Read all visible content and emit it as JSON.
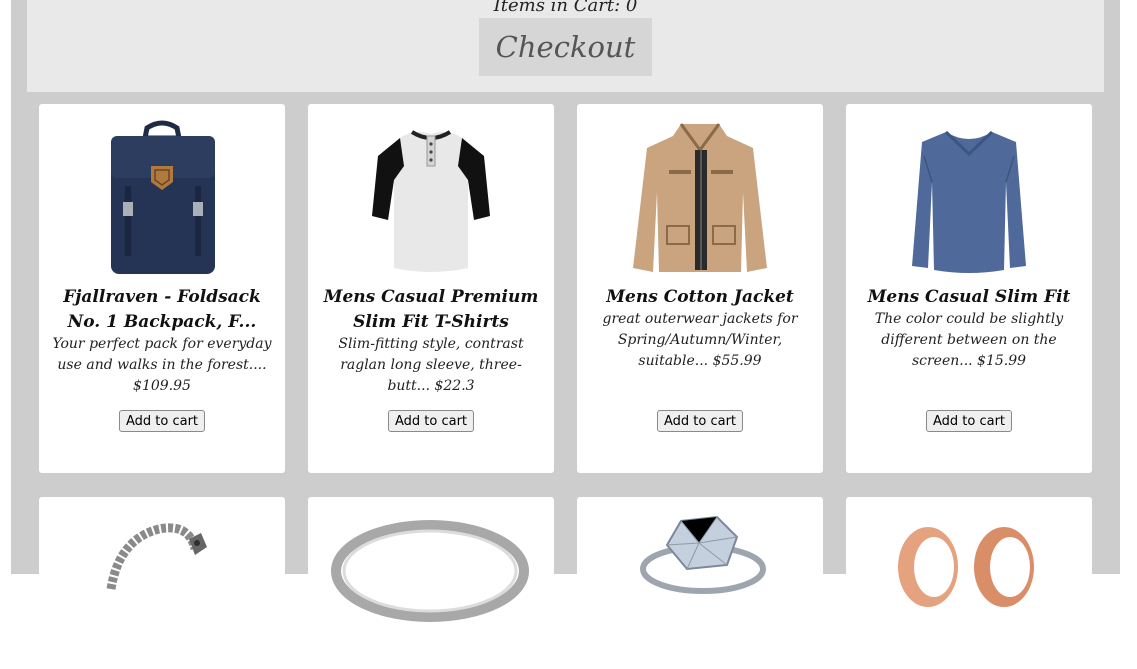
{
  "header": {
    "items_in_cart": "Items in Cart: 0",
    "checkout_label": "Checkout"
  },
  "products": [
    {
      "title": "Fjallraven - Foldsack No. 1 Backpack, F...",
      "description": "Your perfect pack for everyday use and walks in the forest.... $109.95",
      "button": "Add to cart",
      "image": "backpack-image"
    },
    {
      "title": "Mens Casual Premium Slim Fit T-Shirts",
      "description": "Slim-fitting style, contrast raglan long sleeve, three-butt... $22.3",
      "button": "Add to cart",
      "image": "tshirt-image"
    },
    {
      "title": "Mens Cotton Jacket",
      "description": "great outerwear jackets for Spring/Autumn/Winter, suitable... $55.99",
      "button": "Add to cart",
      "image": "jacket-image"
    },
    {
      "title": "Mens Casual Slim Fit",
      "description": "The color could be slightly different between on the screen... $15.99",
      "button": "Add to cart",
      "image": "longsleeve-shirt-image"
    }
  ],
  "row2": [
    {
      "image": "bracelet-image"
    },
    {
      "image": "silver-ring-image"
    },
    {
      "image": "diamond-ring-image"
    },
    {
      "image": "rose-gold-rings-image"
    }
  ],
  "colors": {
    "page_bg": "#cdcdcd",
    "header_bg": "#e9e9e9",
    "checkout_bg": "#d6d6d6",
    "backpack": "#253454",
    "jacket": "#c9a47f",
    "shirt_blue": "#4f6a9a"
  }
}
